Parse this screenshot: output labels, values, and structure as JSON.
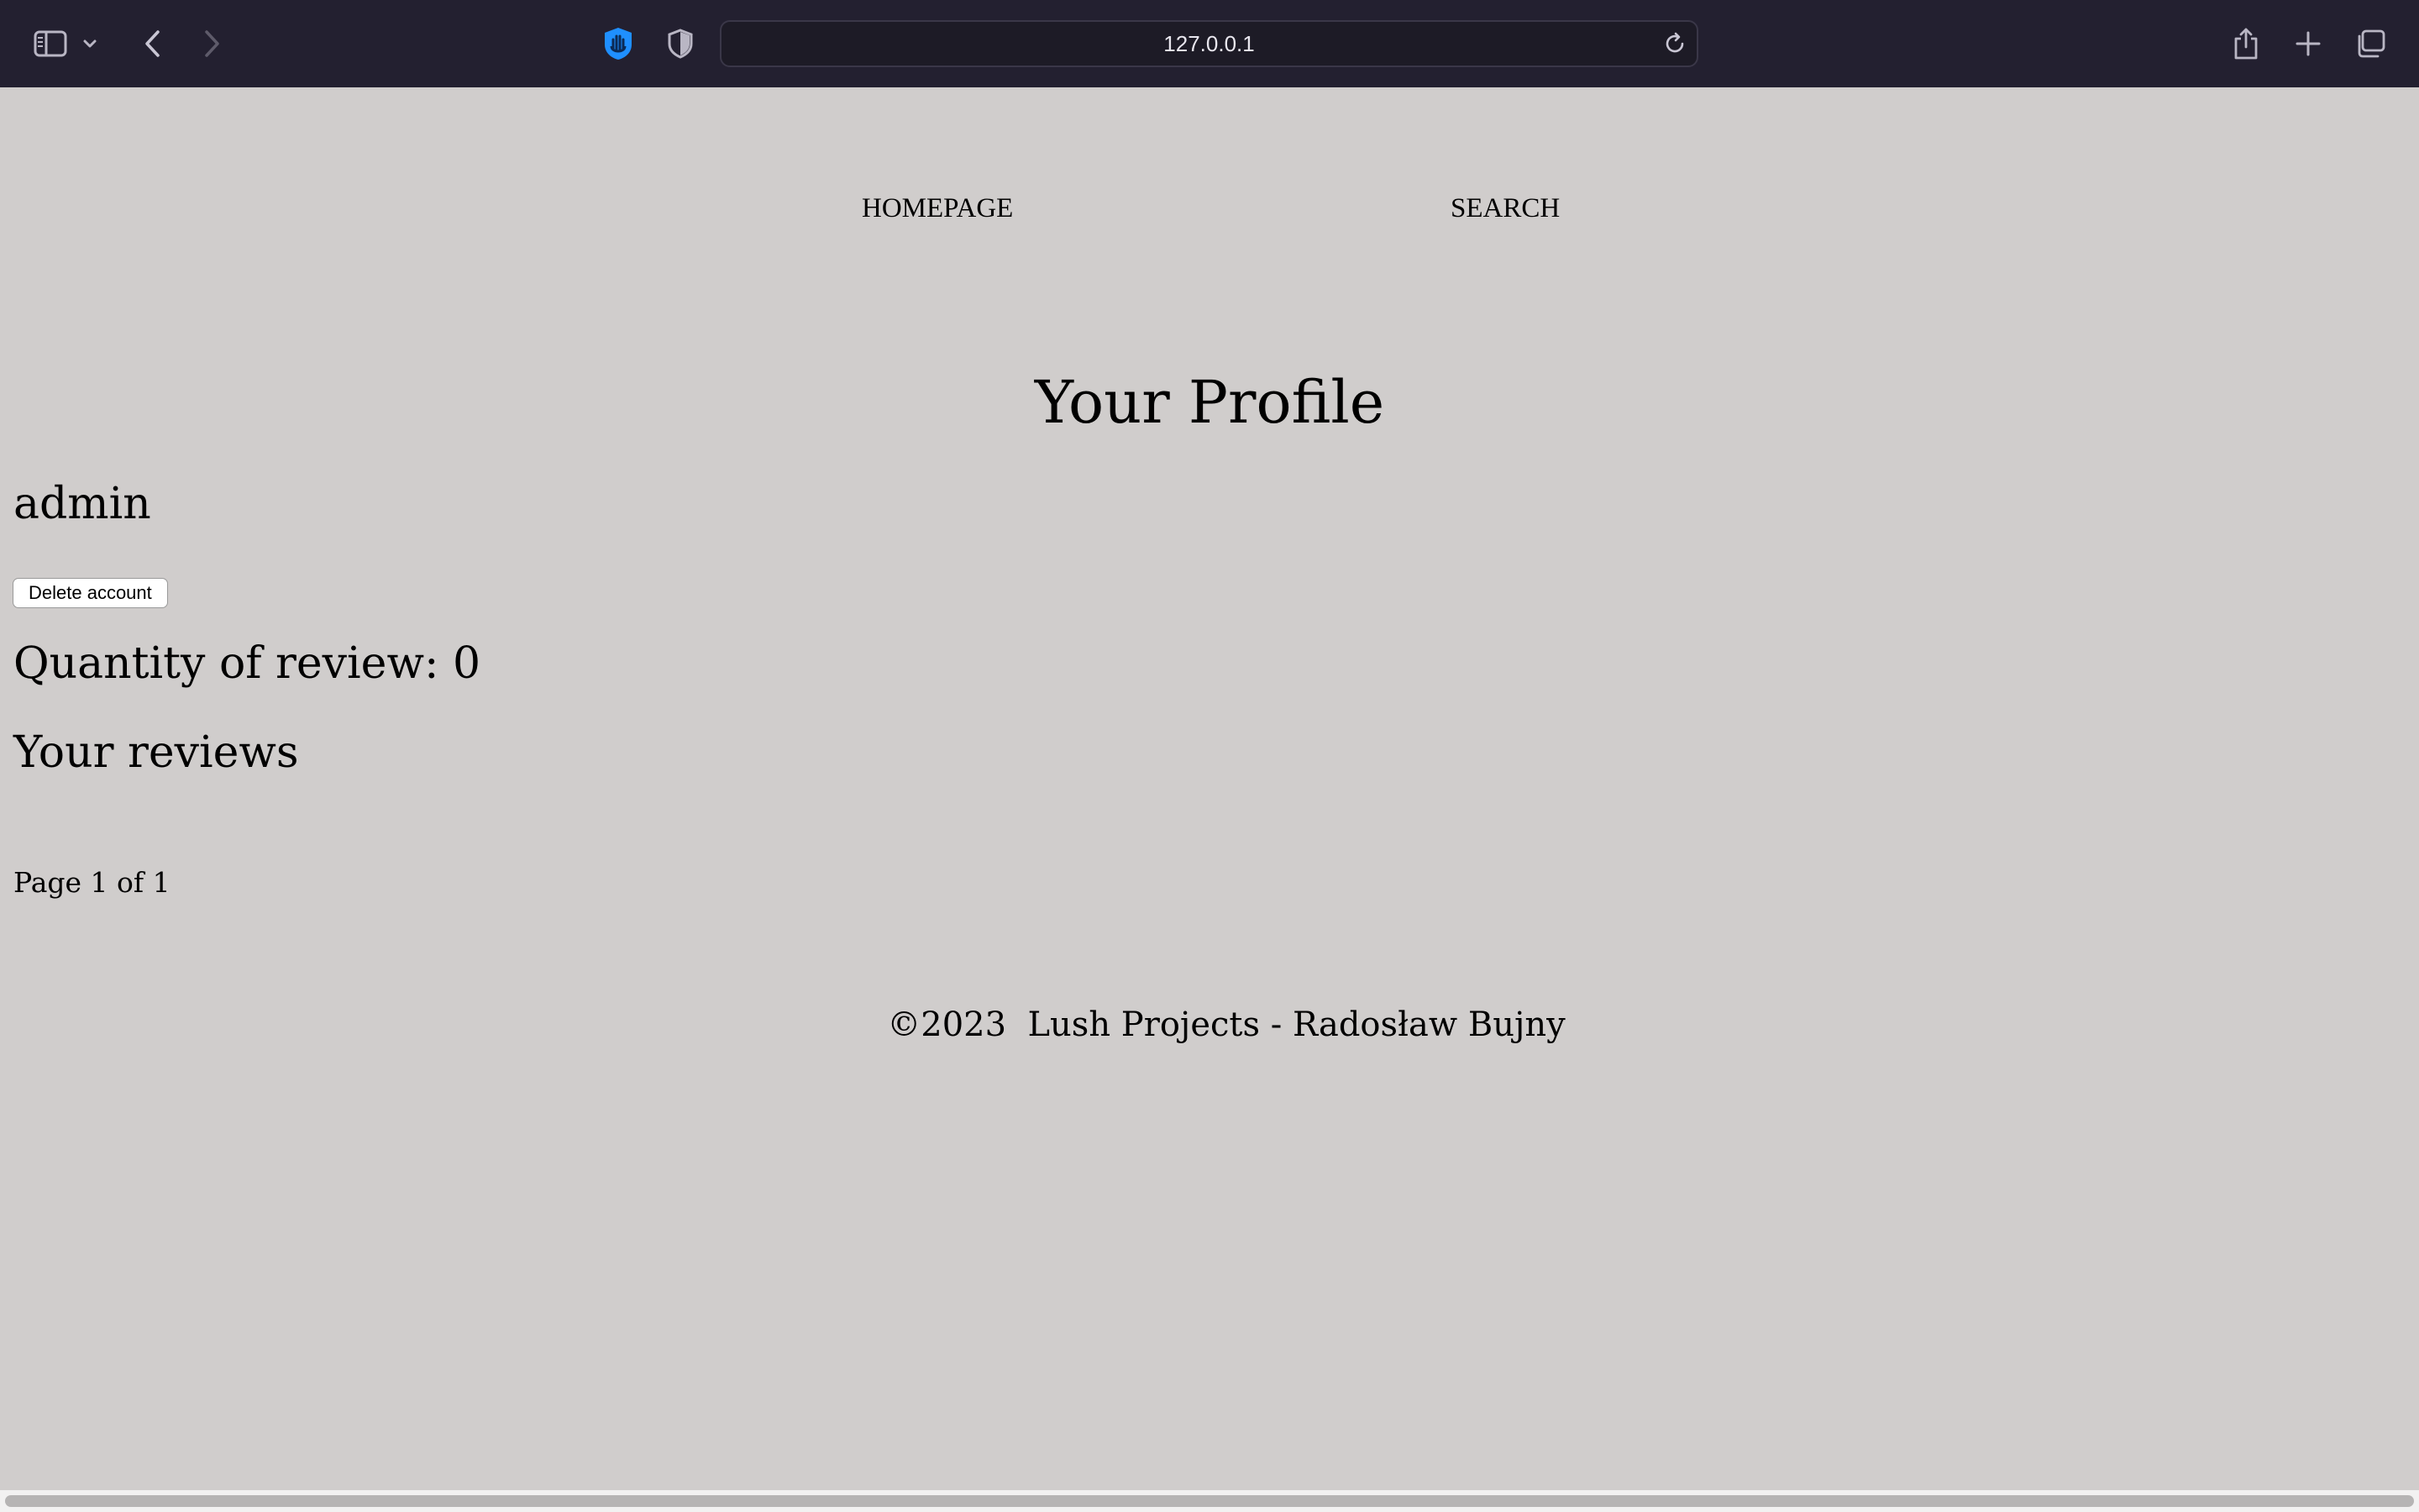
{
  "browser": {
    "url": "127.0.0.1",
    "icons": {
      "sidebar": "sidebar-icon",
      "sidebar_menu": "chevron-down-icon",
      "back": "chevron-left-icon",
      "forward": "chevron-right-icon",
      "extension": "hand-shield-icon",
      "privacy": "shield-icon",
      "reload": "reload-icon",
      "share": "share-icon",
      "new_tab": "plus-icon",
      "tabs": "tabs-overview-icon"
    },
    "colors": {
      "toolbar": "#232030",
      "accent": "#1f8fff"
    }
  },
  "nav": {
    "homepage": "HOMEPAGE",
    "search": "SEARCH"
  },
  "profile": {
    "title": "Your Profile",
    "username": "admin",
    "delete_button": "Delete account",
    "quantity": "Quantity of review: 0",
    "reviews_heading": "Your reviews",
    "pagination": "Page 1 of 1"
  },
  "footer": {
    "text": "©2023  Lush Projects - Radosław Bujny"
  },
  "colors": {
    "page_background": "#d0cdcc"
  }
}
